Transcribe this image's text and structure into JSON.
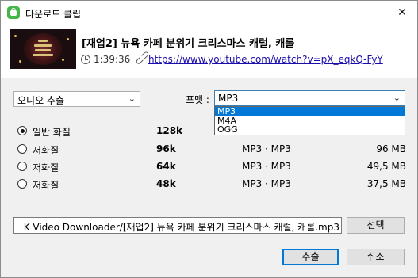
{
  "window": {
    "title": "다운로드 클립",
    "close_glyph": "✕"
  },
  "video": {
    "title": "[재업2] 뉴욕 카페 분위기 크리스마스 캐럴, 캐롤",
    "duration": "1:39:36",
    "url": "https://www.youtube.com/watch?v=pX_eqkQ-FyY"
  },
  "extraction": {
    "selected": "오디오 추출"
  },
  "format": {
    "label": "포맷 :",
    "selected": "MP3",
    "options": [
      "MP3",
      "M4A",
      "OGG"
    ],
    "highlighted_option": "MP3"
  },
  "qualities": [
    {
      "label": "일반 화질",
      "bitrate": "128k",
      "format": "",
      "size": "",
      "selected": true
    },
    {
      "label": "저화질",
      "bitrate": "96k",
      "format": "MP3 · MP3",
      "size": "96 MB",
      "selected": false
    },
    {
      "label": "저화질",
      "bitrate": "64k",
      "format": "MP3 · MP3",
      "size": "49,5 MB",
      "selected": false
    },
    {
      "label": "저화질",
      "bitrate": "48k",
      "format": "MP3 · MP3",
      "size": "37,5 MB",
      "selected": false
    }
  ],
  "output": {
    "path": "K Video Downloader/[재업2] 뉴욕 카페 분위기 크리스마스 캐럴, 캐롤.mp3",
    "browse_label": "선택"
  },
  "buttons": {
    "ok": "추출",
    "cancel": "취소"
  },
  "colors": {
    "accent": "#0078d7",
    "link": "#1a0dab",
    "app_icon": "#45b649"
  }
}
